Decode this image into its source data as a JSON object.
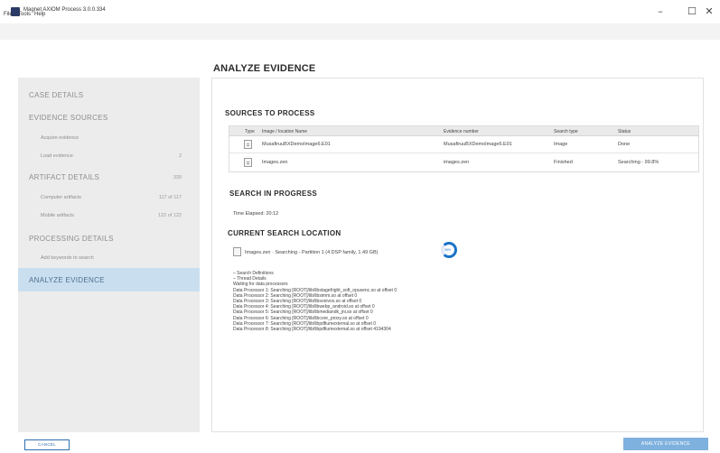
{
  "window": {
    "title": "Magnet AXIOM Process 3.0.0.334",
    "minimize_glyph": "–",
    "maximize_glyph": "☐",
    "close_glyph": "✕",
    "icon": "magnet-app-icon"
  },
  "menu": {
    "file": "File",
    "tools": "Tools",
    "help": "Help"
  },
  "sidebar": {
    "case_details": "CASE DETAILS",
    "evidence_sources": "EVIDENCE SOURCES",
    "acquire_evidence": "Acquire evidence",
    "load_evidence": "Load evidence",
    "load_evidence_count": "2",
    "artifact_details": "ARTIFACT DETAILS",
    "artifact_details_count": "339",
    "computer_artifacts": "Computer artifacts",
    "computer_artifacts_count": "117 of 117",
    "mobile_artifacts": "Mobile artifacts",
    "mobile_artifacts_count": "122 of 122",
    "processing_details": "PROCESSING DETAILS",
    "add_keywords": "Add keywords to search",
    "analyze_evidence": "ANALYZE EVIDENCE"
  },
  "main": {
    "title": "ANALYZE EVIDENCE",
    "sources_heading": "SOURCES TO PROCESS",
    "table": {
      "columns": [
        "Type",
        "Image / location Name",
        "Evidence number",
        "Search type",
        "Status"
      ],
      "rows": [
        {
          "name": "MusafiruuBXDemoImage6.E01",
          "evidence": "MusafiruuBXDemoImage6.E01",
          "search_type": "Image",
          "status": "Done"
        },
        {
          "name": "Images.zen",
          "evidence": "images.zen",
          "search_type": "Finished",
          "status": "Searching - 99.8%"
        }
      ]
    },
    "search_heading": "SEARCH IN PROGRESS",
    "time_elapsed": "Time Elapsed: 20:12",
    "current_location_heading": "CURRENT SEARCH LOCATION",
    "current_location_text": "Images.zen · Searching - Partition 1 (4 DSP family, 1.49 GB)",
    "spinner_pct": "55%",
    "tree": [
      "–  Search Definitions",
      "–  Thread Details",
      "     Waiting for data processors",
      "        Data Processor 1:  Searching [ROOT]/lib/libstagefright_soft_opusenc.so at offset 0",
      "        Data Processor 2:  Searching [ROOT]/lib/libsimm.so at offset 0",
      "        Data Processor 3:  Searching [ROOT]/lib/libsonivox.so at offset 0",
      "        Data Processor 4:  Searching [ROOT]/lib/libwebp_android.so at offset 0",
      "        Data Processor 5:  Searching [ROOT]/lib/libmediandk_jni.so at offset 0",
      "        Data Processor 6:  Searching [ROOT]/lib/libcore_proxy.so at offset 0",
      "        Data Processor 7:  Searching [ROOT]/lib/libpdfiumexternal.so at offset 0",
      "        Data Processor 8:  Searching [ROOT]/lib/libpdfiumexternal.so at offset 4194304"
    ]
  },
  "footer": {
    "cancel": "CANCEL",
    "analyze": "ANALYZE EVIDENCE"
  },
  "colors": {
    "accent": "#1a73c8",
    "sidebar_bg": "#ececec",
    "sidebar_active": "#c9dff0",
    "primary_button": "#7fb1de"
  }
}
